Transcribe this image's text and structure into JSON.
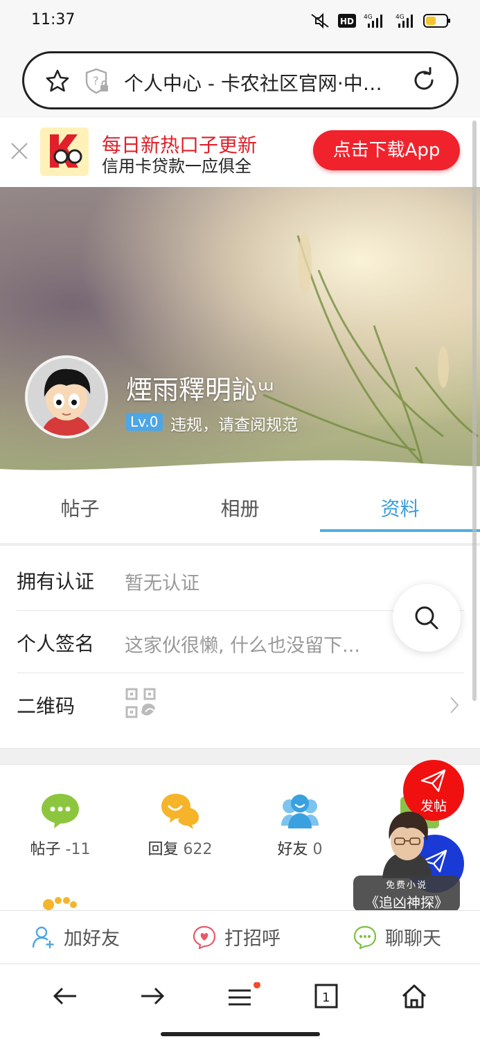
{
  "status_bar": {
    "time": "11:37",
    "hd_label": "HD",
    "net1": "4G",
    "net2": "4G"
  },
  "browser": {
    "url_title": "个人中心 - 卡农社区官网·中…"
  },
  "ad": {
    "title": "每日新热口子更新",
    "subtitle": "信用卡贷款一应俱全",
    "button": "点击下载App",
    "accent_color": "#f0232d"
  },
  "profile": {
    "nickname": "煙雨釋明訫ᵚ",
    "level": "Lv.0",
    "status_text": "违规，请查阅规范"
  },
  "tabs": [
    {
      "label": "帖子",
      "active": false
    },
    {
      "label": "相册",
      "active": false
    },
    {
      "label": "资料",
      "active": true
    }
  ],
  "info_rows": {
    "cert_label": "拥有认证",
    "cert_value": "暂无认证",
    "sign_label": "个人签名",
    "sign_value": "这家伙很懒, 什么也没留下...",
    "qr_label": "二维码"
  },
  "stats": [
    {
      "label": "帖子",
      "count": "-11",
      "icon": "speech-bubble-icon",
      "color": "#8cc63e"
    },
    {
      "label": "回复",
      "count": "622",
      "icon": "chat-bubbles-icon",
      "color": "#f5b42a"
    },
    {
      "label": "好友",
      "count": "0",
      "icon": "friends-icon",
      "color": "#3aa1e0"
    }
  ],
  "fab": {
    "post_label": "发帖"
  },
  "novel_ad": {
    "free_label": "免费小说",
    "title": "《追凶神探》"
  },
  "actions": {
    "add_friend": "加好友",
    "greet": "打招呼",
    "chat": "聊聊天"
  },
  "nav": {
    "tab_count": "1"
  }
}
